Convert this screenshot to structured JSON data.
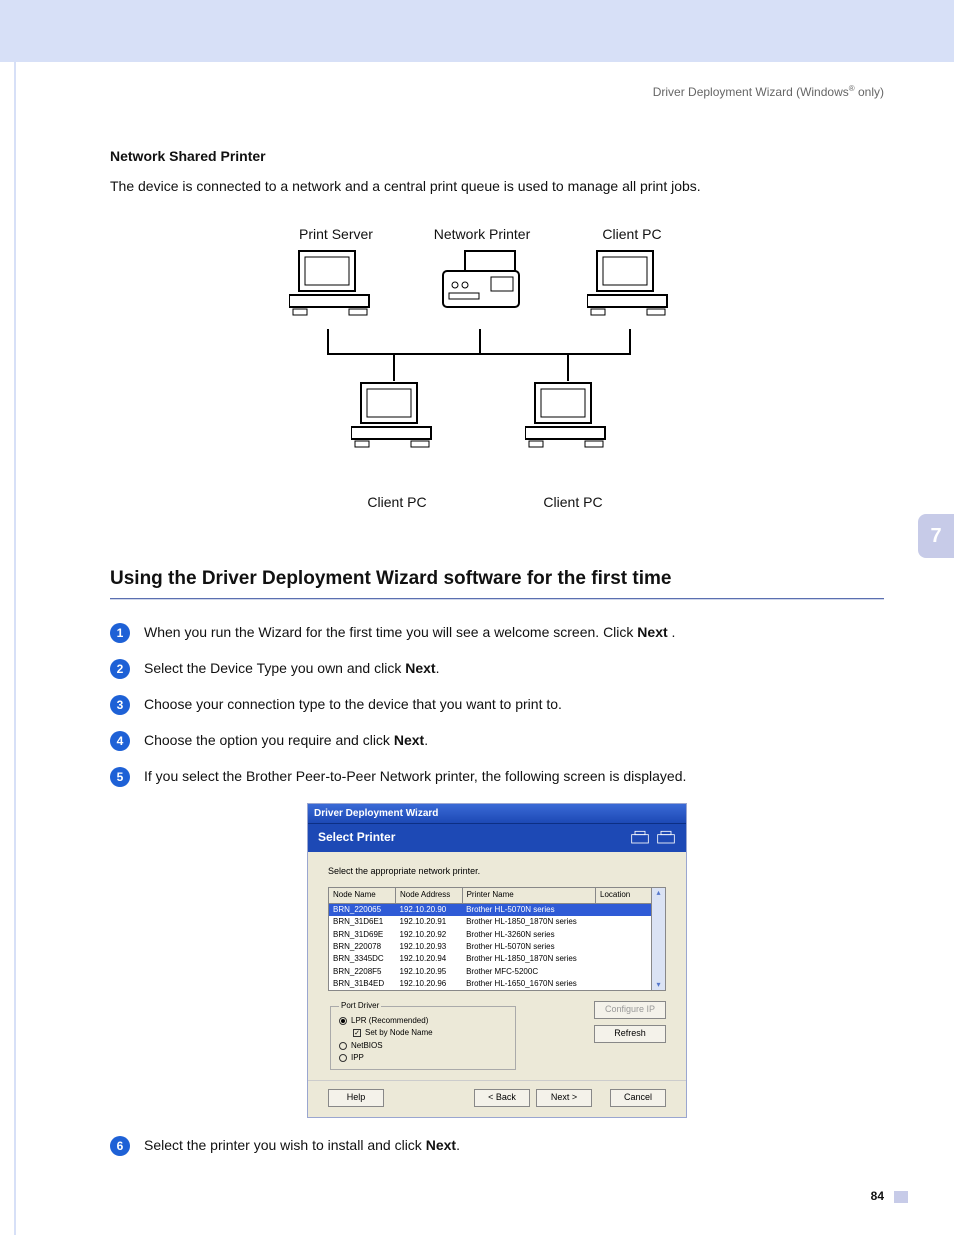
{
  "running_head_pre": "Driver Deployment Wizard (Windows",
  "running_head_post": " only)",
  "section_title": "Network Shared Printer",
  "section_para": "The device is connected to a network and a central print queue is used to manage all print jobs.",
  "diagram": {
    "print_server": "Print Server",
    "network_printer": "Network Printer",
    "client_pc": "Client PC"
  },
  "h2": "Using the Driver Deployment Wizard software for the first time",
  "steps": [
    {
      "pre": "When you run the Wizard for the first time you will see a welcome screen. Click ",
      "bold": "Next",
      "post": " ."
    },
    {
      "pre": "Select the Device Type you own and click ",
      "bold": "Next",
      "post": "."
    },
    {
      "pre": "Choose your connection type to the device that you want to print to.",
      "bold": "",
      "post": ""
    },
    {
      "pre": "Choose the option you require and click ",
      "bold": "Next",
      "post": "."
    },
    {
      "pre": "If you select the Brother Peer-to-Peer Network printer, the following screen is displayed.",
      "bold": "",
      "post": ""
    },
    {
      "pre": "Select the printer you wish to install and click ",
      "bold": "Next",
      "post": "."
    }
  ],
  "wizard": {
    "title": "Driver Deployment Wizard",
    "band": "Select Printer",
    "hint": "Select the appropriate network printer.",
    "columns": [
      "Node Name",
      "Node Address",
      "Printer Name",
      "Location"
    ],
    "rows": [
      {
        "sel": true,
        "cells": [
          "BRN_220065",
          "192.10.20.90",
          "Brother HL-5070N series",
          ""
        ]
      },
      {
        "sel": false,
        "cells": [
          "BRN_31D6E1",
          "192.10.20.91",
          "Brother HL-1850_1870N series",
          ""
        ]
      },
      {
        "sel": false,
        "cells": [
          "BRN_31D69E",
          "192.10.20.92",
          "Brother HL-3260N series",
          ""
        ]
      },
      {
        "sel": false,
        "cells": [
          "BRN_220078",
          "192.10.20.93",
          "Brother HL-5070N series",
          ""
        ]
      },
      {
        "sel": false,
        "cells": [
          "BRN_3345DC",
          "192.10.20.94",
          "Brother HL-1850_1870N series",
          ""
        ]
      },
      {
        "sel": false,
        "cells": [
          "BRN_2208F5",
          "192.10.20.95",
          "Brother MFC-5200C",
          ""
        ]
      },
      {
        "sel": false,
        "cells": [
          "BRN_31B4ED",
          "192.10.20.96",
          "Brother HL-1650_1670N series",
          ""
        ]
      }
    ],
    "port_legend": "Port Driver",
    "radios": {
      "lpr": "LPR (Recommended)",
      "set_by_node": "Set by Node Name",
      "netbios": "NetBIOS",
      "ipp": "IPP"
    },
    "buttons": {
      "configure": "Configure IP",
      "refresh": "Refresh",
      "help": "Help",
      "back": "< Back",
      "next": "Next >",
      "cancel": "Cancel"
    }
  },
  "side_tab": "7",
  "page_number": "84"
}
